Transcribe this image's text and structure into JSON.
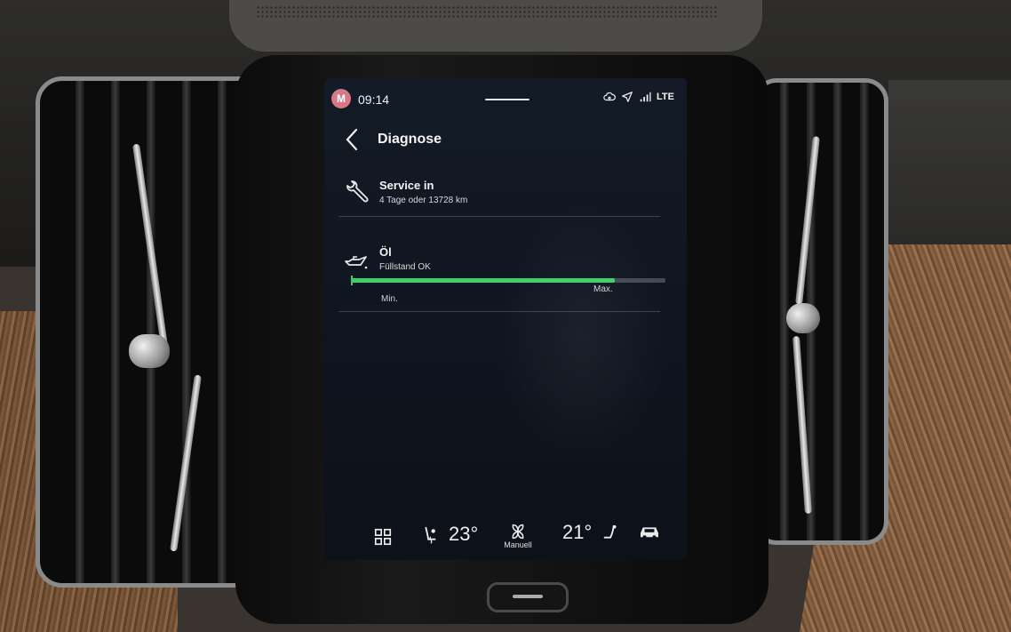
{
  "status_bar": {
    "avatar_initial": "M",
    "time": "09:14",
    "network": "LTE",
    "icons": [
      "cloud-sync-icon",
      "navigation-arrow-icon",
      "signal-bars-icon"
    ]
  },
  "header": {
    "back_icon": "chevron-left-icon",
    "title": "Diagnose"
  },
  "service": {
    "icon": "wrench-icon",
    "title": "Service in",
    "detail": "4 Tage oder 13728 km"
  },
  "oil": {
    "icon": "oil-can-icon",
    "title": "Öl",
    "status": "Füllstand OK",
    "level_fraction": 0.84,
    "min_label": "Min.",
    "max_label": "Max."
  },
  "climate": {
    "home_icon": "app-grid-icon",
    "left_seat_icon": "seat-heating-icon",
    "left_temp": "23°",
    "fan_icon": "fan-icon",
    "fan_mode": "Manuell",
    "right_temp": "21°",
    "right_seat_icon": "seat-icon",
    "car_icon": "car-icon"
  },
  "colors": {
    "accent_green": "#3fcf6a",
    "screen_bg": "#131b26"
  }
}
